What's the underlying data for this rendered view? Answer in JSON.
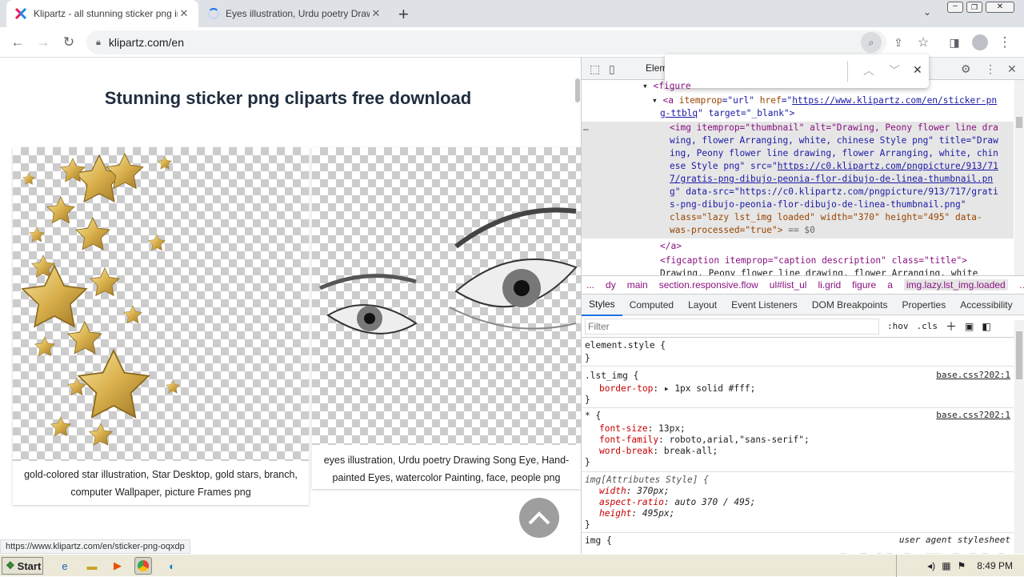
{
  "browser": {
    "tabs": [
      {
        "title": "Klipartz - all stunning sticker png ima",
        "close": "✕"
      },
      {
        "title": "Eyes illustration, Urdu poetry Drawin",
        "close": "✕"
      }
    ],
    "new_tab": "+",
    "url": "klipartz.com/en",
    "status_url": "https://www.klipartz.com/en/sticker-png-oqxdp"
  },
  "page": {
    "heading": "Stunning sticker png cliparts free download",
    "cards": [
      {
        "caption": "gold-colored star illustration, Star Desktop, gold stars, branch, computer Wallpaper, picture Frames png"
      },
      {
        "caption": "eyes illustration, Urdu poetry Drawing Song Eye, Hand-painted Eyes, watercolor Painting, face, people png"
      }
    ]
  },
  "devtools": {
    "tab_elements": "Elem",
    "dom": {
      "l1_tag": "<figure",
      "l2_open": "<a ",
      "l2_attr1": "itemprop",
      "l2_val1": "=\"url\"",
      "l2_attr2": " href",
      "l2_eq": "=\"",
      "l2_href": "https://www.klipartz.com/en/sticker-pn",
      "l3_href": "g-ttblq",
      "l3_rest": "\" target=\"_blank\">",
      "l4": "<img itemprop=\"thumbnail\" alt=\"Drawing, Peony flower line dra",
      "l5": "wing, flower Arranging, white, chinese Style png\" title=\"Draw",
      "l6": "ing, Peony flower line drawing, flower Arranging, white, chin",
      "l7a": "ese Style png\" src=\"",
      "l7b": "https://c0.klipartz.com/pngpicture/913/71",
      "l8": "7/gratis-png-dibujo-peonia-flor-dibujo-de-linea-thumbnail.pn",
      "l9a": "g",
      "l9b": "\" data-src=\"https://c0.klipartz.com/pngpicture/913/717/grati",
      "l10": "s-png-dibujo-peonia-flor-dibujo-de-linea-thumbnail.png\"",
      "l11": "class=\"lazy lst_img loaded\" width=\"370\" height=\"495\" data-",
      "l12a": "was-processed=\"true\">",
      "l12b": " == $0",
      "l13": "</a>",
      "l14": "<figcaption itemprop=\"caption description\" class=\"title\">",
      "l15": "Drawing, Peony flower line drawing, flower Arranging, white"
    },
    "dots": "…",
    "breadcrumbs": [
      "...",
      "dy",
      "main",
      "section.responsive.flow",
      "ul#list_ul",
      "li.grid",
      "figure",
      "a",
      "img.lazy.lst_img.loaded",
      "…"
    ],
    "style_tabs": [
      "Styles",
      "Computed",
      "Layout",
      "Event Listeners",
      "DOM Breakpoints",
      "Properties",
      "Accessibility"
    ],
    "filter_placeholder": "Filter",
    "hov": ":hov",
    "cls": ".cls",
    "rules": [
      {
        "selector": "element.style {",
        "close": "}"
      },
      {
        "selector": ".lst_img {",
        "source": "base.css?202:1",
        "props": [
          {
            "name": "border-top",
            "value": "1px solid #fff;"
          }
        ],
        "close": "}"
      },
      {
        "selector": "* {",
        "source": "base.css?202:1",
        "props": [
          {
            "name": "font-size",
            "value": "13px;"
          },
          {
            "name": "font-family",
            "value": "roboto,arial,\"sans-serif\";"
          },
          {
            "name": "word-break",
            "value": "break-all;"
          }
        ],
        "close": "}"
      },
      {
        "selector": "img[Attributes Style] {",
        "props": [
          {
            "name": "width",
            "value": "370px;"
          },
          {
            "name": "aspect-ratio",
            "value": "auto 370 / 495;"
          },
          {
            "name": "height",
            "value": "495px;"
          }
        ],
        "close": "}"
      },
      {
        "selector": "img {",
        "source": "user agent stylesheet"
      }
    ]
  },
  "taskbar": {
    "start": "Start",
    "time": "8:49 PM"
  },
  "watermark": "ANY RUN"
}
